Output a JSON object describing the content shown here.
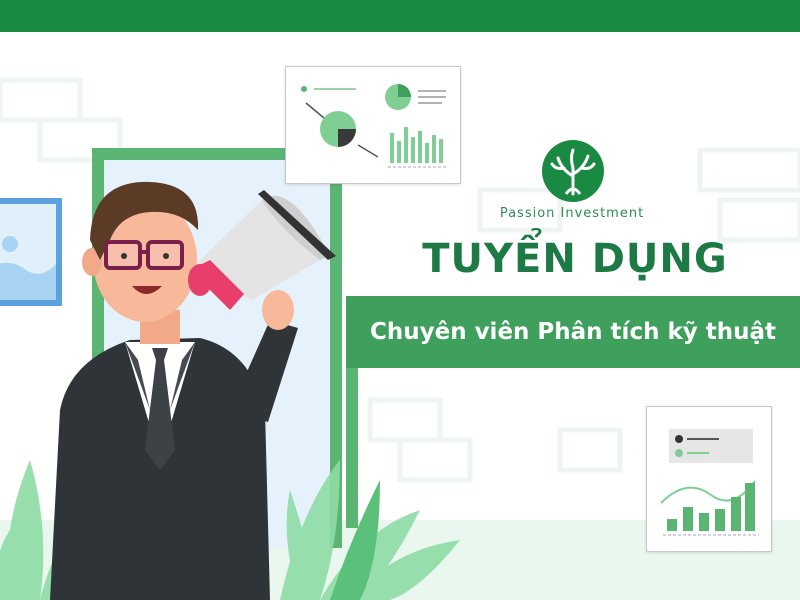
{
  "brand": {
    "name": "Passion Investment",
    "logo_icon": "tree-logo-icon"
  },
  "headline": "TUYỂN DỤNG",
  "position_title": "Chuyên viên Phân tích kỹ thuật",
  "colors": {
    "brand_green": "#1a8a43",
    "band_green": "#3f9f5d",
    "text_green": "#1d7a44",
    "light_green": "#5bb572",
    "megaphone_pink": "#e83e6c",
    "suit_dark": "#2f3438"
  },
  "illustration": {
    "person": "man-with-megaphone",
    "megaphone_icon": "megaphone-icon",
    "chart_cards": [
      "dashboard-card-pie-bar",
      "dashboard-card-line-bar"
    ],
    "plants": "plant-leaves"
  }
}
